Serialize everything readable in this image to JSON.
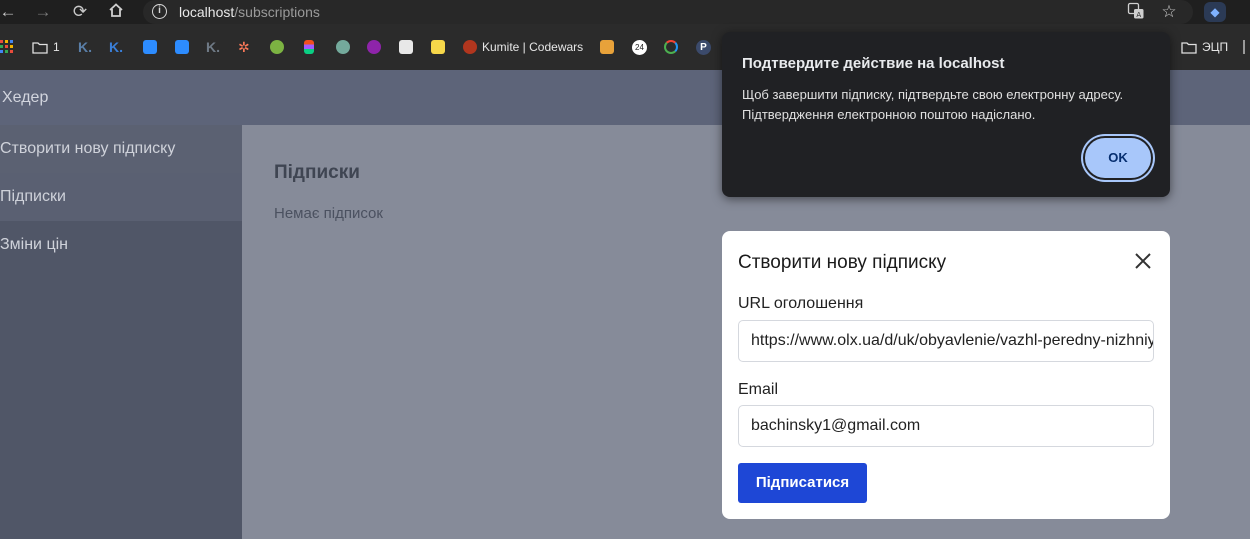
{
  "browser": {
    "url_host": "localhost",
    "url_path": "/subscriptions",
    "bookmarks": {
      "folder1": "1",
      "kumite": "Kumite | Codewars",
      "counter": "24",
      "folder_ecp": "ЭЦП"
    }
  },
  "app": {
    "header_title": "Хедер",
    "sidebar": {
      "items": [
        {
          "label": "Створити нову підписку"
        },
        {
          "label": "Підписки"
        },
        {
          "label": "Зміни цін"
        }
      ]
    },
    "main": {
      "title": "Підписки",
      "empty_text": "Немає підписок"
    }
  },
  "modal": {
    "title": "Створити нову підписку",
    "url_label": "URL оголошення",
    "url_value": "https://www.olx.ua/d/uk/obyavlenie/vazhl-peredny-nizhniy",
    "email_label": "Email",
    "email_value": "bachinsky1@gmail.com",
    "submit_label": "Підписатися"
  },
  "dialog": {
    "title": "Подтвердите действие на localhost",
    "message_line1": "Щоб завершити підписку, підтвердьте свою електронну адресу.",
    "message_line2": "Підтвердження електронною поштою надіслано.",
    "ok_label": "OK"
  }
}
